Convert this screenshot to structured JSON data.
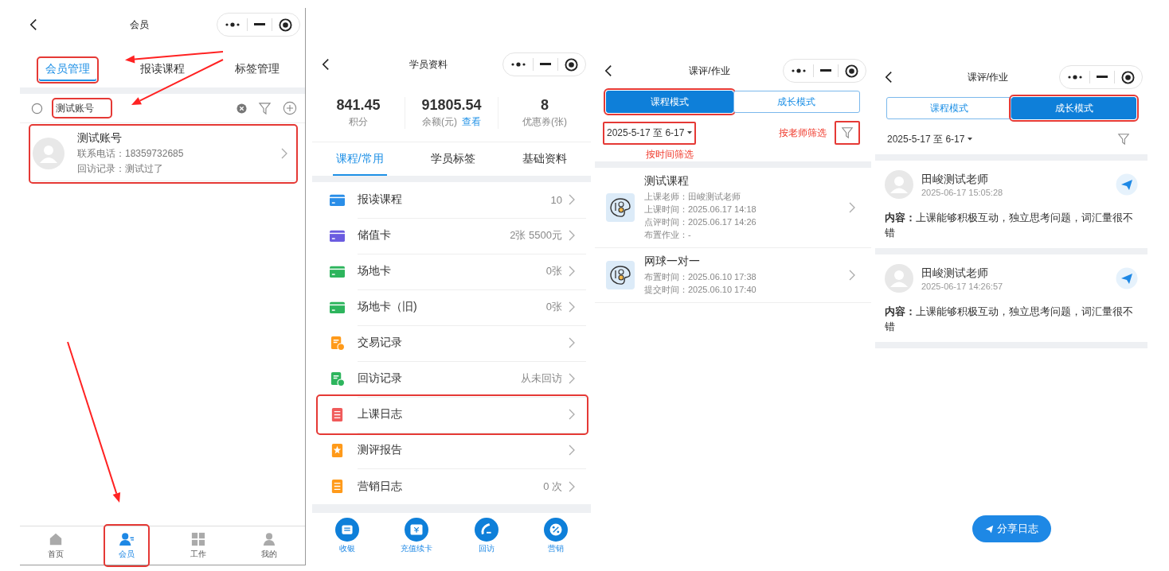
{
  "member_screen": {
    "title": "会员",
    "tabs": [
      {
        "label": "会员管理",
        "selected": true,
        "highlighted": true
      },
      {
        "label": "报读课程",
        "selected": false,
        "highlighted": false
      },
      {
        "label": "标签管理",
        "selected": false,
        "highlighted": false
      }
    ],
    "search": {
      "value": "测试账号",
      "highlighted": true
    },
    "members": [
      {
        "name": "测试账号",
        "phone": "联系电话：18359732685",
        "visit": "回访记录：测试过了",
        "highlighted": true
      }
    ],
    "nav": [
      {
        "label": "首页",
        "selected": false,
        "highlighted": false
      },
      {
        "label": "会员",
        "selected": true,
        "highlighted": true
      },
      {
        "label": "工作",
        "selected": false,
        "highlighted": false
      },
      {
        "label": "我的",
        "selected": false,
        "highlighted": false
      }
    ]
  },
  "student_screen": {
    "title": "学员资料",
    "stats": [
      {
        "value": "841.45",
        "label": "积分"
      },
      {
        "value": "91805.54",
        "label": "余额(元)",
        "link": "查看"
      },
      {
        "value": "8",
        "label": "优惠券(张)"
      }
    ],
    "tabs": [
      {
        "label": "课程/常用",
        "selected": true
      },
      {
        "label": "学员标签",
        "selected": false
      },
      {
        "label": "基础资料",
        "selected": false
      }
    ],
    "menu": [
      {
        "label": "报读课程",
        "value": "10",
        "kind": "card",
        "color": "#2a8ee8",
        "highlighted": false
      },
      {
        "label": "储值卡",
        "value": "2张 5500元",
        "kind": "card",
        "color": "#6b5ce0",
        "highlighted": false
      },
      {
        "label": "场地卡",
        "value": "0张",
        "kind": "card",
        "color": "#2db55d",
        "highlighted": false
      },
      {
        "label": "场地卡（旧)",
        "value": "0张",
        "kind": "card",
        "color": "#2db55d",
        "highlighted": false
      },
      {
        "label": "交易记录",
        "kind": "doc",
        "color": "#ff9a1a",
        "highlighted": false
      },
      {
        "label": "回访记录",
        "value": "从未回访",
        "kind": "doc",
        "color": "#2db55d",
        "highlighted": false
      },
      {
        "label": "上课日志",
        "kind": "list",
        "color": "#f05a5a",
        "highlighted": true
      },
      {
        "label": "测评报告",
        "kind": "star",
        "color": "#ff9a1a",
        "highlighted": false
      },
      {
        "label": "营销日志",
        "value": "0 次",
        "kind": "list",
        "color": "#ff9a1a",
        "highlighted": false
      }
    ],
    "actions": [
      {
        "label": "收银"
      },
      {
        "label": "充值续卡"
      },
      {
        "label": "回访"
      },
      {
        "label": "营销"
      }
    ]
  },
  "review_screens": [
    {
      "title": "课评/作业",
      "modes": [
        {
          "label": "课程模式",
          "selected": true,
          "highlighted": true
        },
        {
          "label": "成长模式",
          "selected": false,
          "highlighted": false
        }
      ],
      "date_range": {
        "value": "2025-5-17 至 6-17",
        "highlighted": true
      },
      "date_note": "按时间筛选",
      "filter_note": "按老师筛选",
      "filter": {
        "highlighted": true
      },
      "courses": [
        {
          "title": "测试课程",
          "lines": [
            "上课老师：田峻测试老师",
            "上课时间：2025.06.17 14:18",
            "点评时间：2025.06.17 14:26",
            "布置作业：-"
          ]
        },
        {
          "title": "网球一对一",
          "lines": [
            "布置时间：2025.06.10 17:38",
            "提交时间：2025.06.10 17:40"
          ]
        }
      ]
    },
    {
      "title": "课评/作业",
      "modes": [
        {
          "label": "课程模式",
          "selected": false,
          "highlighted": false
        },
        {
          "label": "成长模式",
          "selected": true,
          "highlighted": true
        }
      ],
      "date_range": {
        "value": "2025-5-17 至 6-17",
        "highlighted": false
      },
      "filter": {
        "highlighted": false
      },
      "logs": [
        {
          "teacher": "田峻测试老师",
          "time": "2025-06-17 15:05:28",
          "content": "**内容：**上课能够积极互动，独立思考问题，词汇量很不错"
        },
        {
          "teacher": "田峻测试老师",
          "time": "2025-06-17 14:26:57",
          "content": "**内容：**上课能够积极互动，独立思考问题，词汇量很不错"
        }
      ],
      "share_button": "分享日志"
    }
  ]
}
